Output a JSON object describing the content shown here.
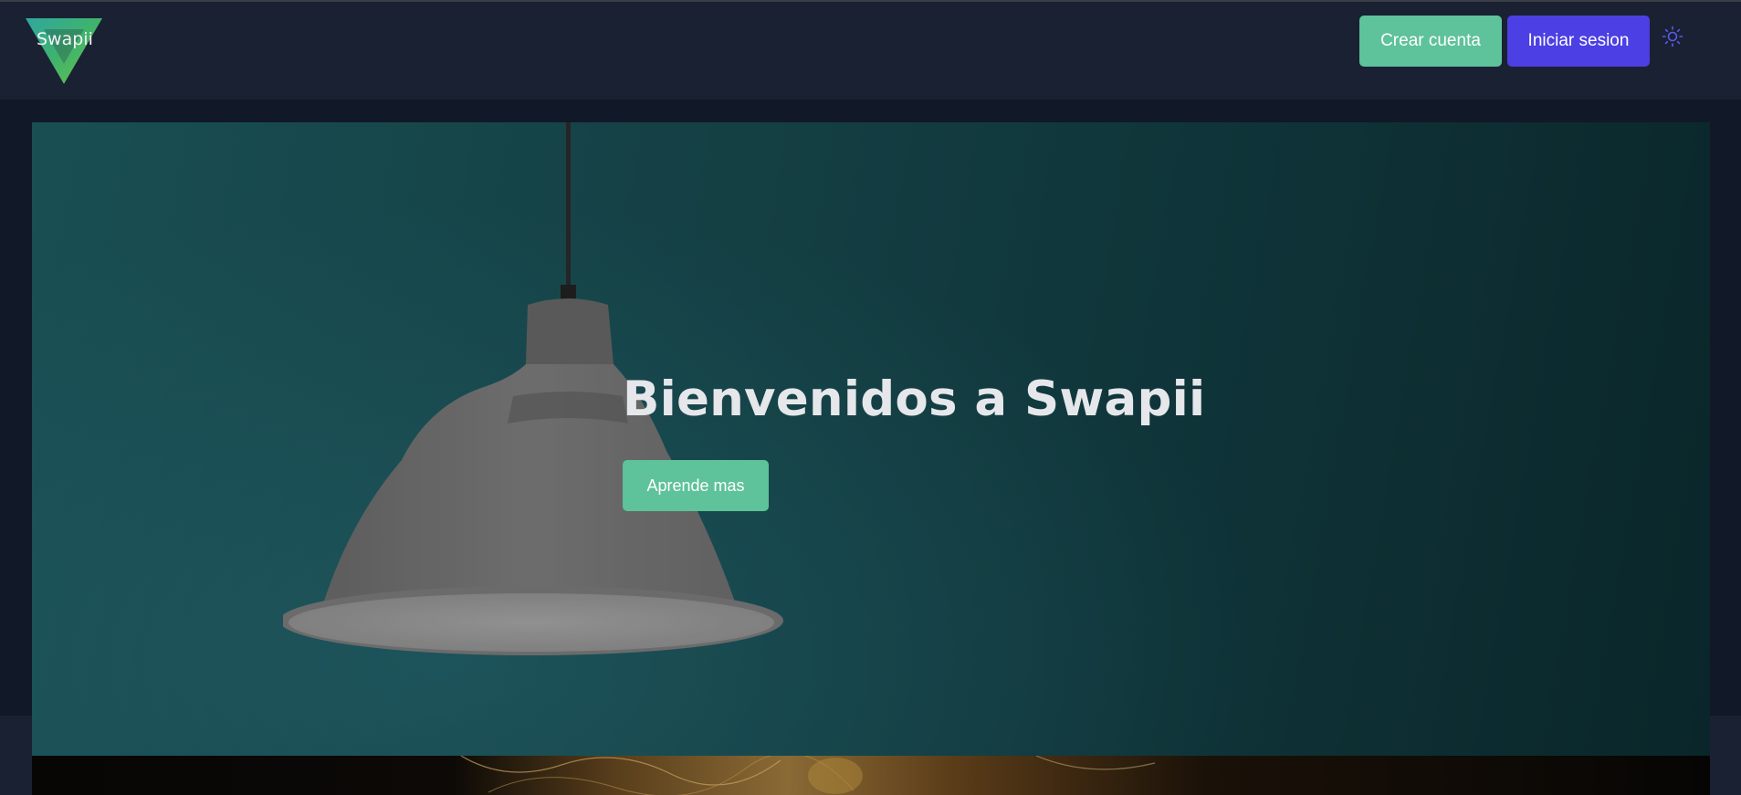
{
  "brand": {
    "name": "Swapii",
    "logo_icon": "green-triangle-logo-icon"
  },
  "header": {
    "signup_label": "Crear cuenta",
    "login_label": "Iniciar sesion",
    "theme_icon": "sun-icon"
  },
  "hero": {
    "title": "Bienvenidos a Swapii",
    "cta_label": "Aprende mas",
    "image": "pendant-lamp-on-teal-wall"
  },
  "colors": {
    "page_background": "#111827",
    "navbar": "#1a2132",
    "accent_green": "#5ec29a",
    "accent_indigo": "#4c3fe4",
    "hero_teal": "#184b50"
  }
}
